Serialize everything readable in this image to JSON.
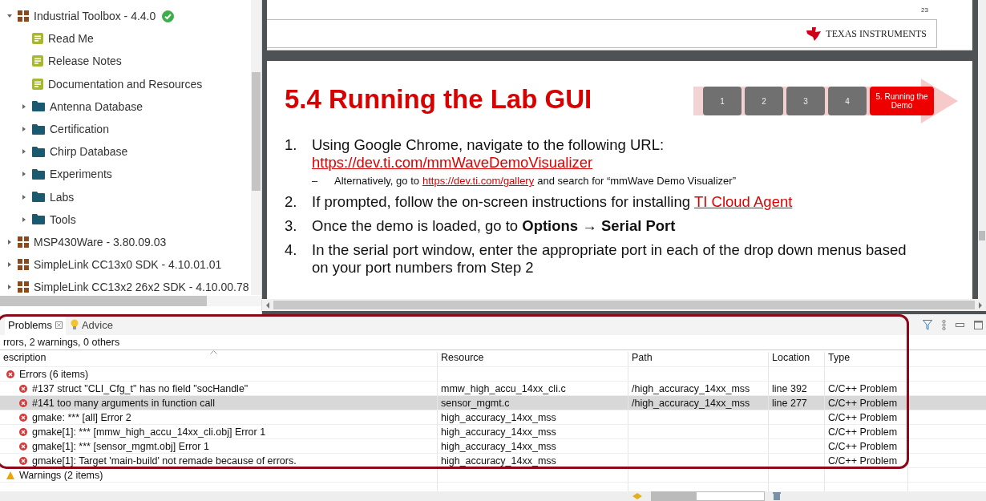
{
  "tree": [
    {
      "label": "Industrial Toolbox - 4.4.0",
      "kind": "package",
      "expanded": true,
      "verified": true,
      "children": [
        {
          "label": "Read Me",
          "kind": "doc"
        },
        {
          "label": "Release Notes",
          "kind": "doc"
        },
        {
          "label": "Documentation and Resources",
          "kind": "doc"
        },
        {
          "label": "Antenna Database",
          "kind": "folder",
          "expanded": false
        },
        {
          "label": "Certification",
          "kind": "folder",
          "expanded": false
        },
        {
          "label": "Chirp Database",
          "kind": "folder",
          "expanded": false
        },
        {
          "label": "Experiments",
          "kind": "folder",
          "expanded": false
        },
        {
          "label": "Labs",
          "kind": "folder",
          "expanded": false
        },
        {
          "label": "Tools",
          "kind": "folder",
          "expanded": false
        }
      ]
    },
    {
      "label": "MSP430Ware - 3.80.09.03",
      "kind": "package",
      "expanded": false
    },
    {
      "label": "SimpleLink CC13x0 SDK - 4.10.01.01",
      "kind": "package",
      "expanded": false
    },
    {
      "label": "SimpleLink CC13x2 26x2 SDK - 4.10.00.78",
      "kind": "package",
      "expanded": false
    }
  ],
  "document": {
    "page_number": "23",
    "brand": "TEXAS INSTRUMENTS",
    "slide": {
      "title": "5.4 Running the Lab GUI",
      "steps": [
        {
          "label": "1",
          "selected": false
        },
        {
          "label": "2",
          "selected": false
        },
        {
          "label": "3",
          "selected": false
        },
        {
          "label": "4",
          "selected": false
        },
        {
          "label": "5. Running the Demo",
          "selected": true
        }
      ],
      "items": [
        {
          "number": "1.",
          "lines": [
            [
              {
                "kind": "text",
                "text": "Using Google Chrome, navigate to the following URL:"
              }
            ],
            [
              {
                "kind": "link",
                "text": "https://dev.ti.com/mmWaveDemoVisualizer"
              }
            ]
          ],
          "sub": [
            {
              "bullet": "–",
              "parts": [
                {
                  "kind": "text",
                  "text": "Alternatively, go to"
                },
                {
                  "kind": "link",
                  "text": "https://dev.ti.com/gallery"
                },
                {
                  "kind": "text",
                  "text": "and search for “mmWave Demo Visualizer”"
                }
              ]
            }
          ]
        },
        {
          "number": "2.",
          "lines": [
            [
              {
                "kind": "text",
                "text": "If prompted, follow the on-screen instructions for installing"
              },
              {
                "kind": "link",
                "text": "TI Cloud Agent"
              }
            ]
          ]
        },
        {
          "number": "3.",
          "lines": [
            [
              {
                "kind": "text",
                "text": "Once the demo is loaded, go to **Options → Serial Port**"
              }
            ]
          ]
        },
        {
          "number": "4.",
          "lines": [
            [
              {
                "kind": "text",
                "text": "In the serial port window, enter the appropriate port in each of the drop down menus based"
              }
            ],
            [
              {
                "kind": "text",
                "text": "on your port numbers from Step 2"
              }
            ]
          ]
        }
      ]
    }
  },
  "problems": {
    "tabs": [
      {
        "label": "Problems",
        "kind": "problems",
        "selected": true
      },
      {
        "label": "Advice",
        "kind": "advice",
        "selected": false
      }
    ],
    "summary": "rrors, 2 warnings, 0 others",
    "columns": [
      "escription",
      "Resource",
      "Path",
      "Location",
      "Type"
    ],
    "groups": [
      {
        "label": "Errors (6 items)",
        "kind": "error",
        "rows": [
          {
            "description": "#137 struct \"CLI_Cfg_t\" has no field \"socHandle\"",
            "resource": "mmw_high_accu_14xx_cli.c",
            "path": "/high_accuracy_14xx_mss",
            "location": "line 392",
            "type": "C/C++ Problem",
            "selected": false
          },
          {
            "description": "#141 too many arguments in function call",
            "resource": "sensor_mgmt.c",
            "path": "/high_accuracy_14xx_mss",
            "location": "line 277",
            "type": "C/C++ Problem",
            "selected": true
          },
          {
            "description": "gmake: *** [all] Error 2",
            "resource": "high_accuracy_14xx_mss",
            "type": "C/C++ Problem",
            "selected": false
          },
          {
            "description": "gmake[1]: *** [mmw_high_accu_14xx_cli.obj] Error 1",
            "resource": "high_accuracy_14xx_mss",
            "type": "C/C++ Problem",
            "selected": false
          },
          {
            "description": "gmake[1]: *** [sensor_mgmt.obj] Error 1",
            "resource": "high_accuracy_14xx_mss",
            "type": "C/C++ Problem",
            "selected": false
          },
          {
            "description": "gmake[1]: Target 'main-build' not remade because of errors.",
            "resource": "high_accuracy_14xx_mss",
            "type": "C/C++ Problem",
            "selected": false
          }
        ]
      },
      {
        "label": "Warnings (2 items)",
        "kind": "warning"
      }
    ]
  }
}
